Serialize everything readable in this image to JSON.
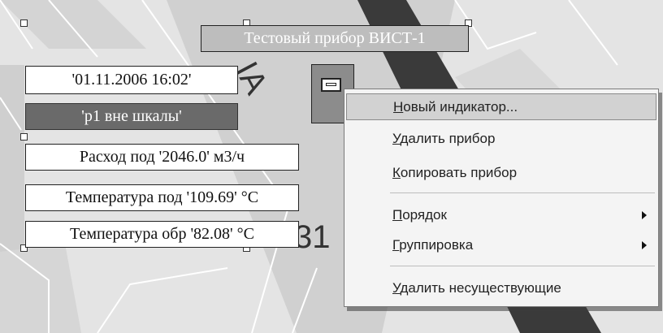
{
  "map": {
    "street_labels": [
      "ІА",
      "31"
    ]
  },
  "device": {
    "title": "Тестовый прибор ВИСТ-1",
    "timestamp": "'01.11.2006  16:02'",
    "out_of_scale": "'p1 вне шкалы'",
    "flow_reading": "Расход под '2046.0' м3/ч",
    "temp_supply": "Температура под '109.69' °С",
    "temp_return": "Температура обр '82.08' °С",
    "icon": "meter-device-icon"
  },
  "context_menu": {
    "items": [
      {
        "accel": "Н",
        "rest": "овый индикатор...",
        "submenu": false,
        "highlighted": true
      },
      {
        "accel": "У",
        "rest": "далить прибор",
        "submenu": false,
        "highlighted": false
      },
      {
        "accel": "К",
        "rest": "опировать прибор",
        "submenu": false,
        "highlighted": false
      },
      {
        "accel": "П",
        "rest": "орядок",
        "submenu": true,
        "highlighted": false
      },
      {
        "accel": "Г",
        "rest": "руппировка",
        "submenu": true,
        "highlighted": false
      },
      {
        "accel": "У",
        "rest": "далить несуществующие",
        "submenu": false,
        "highlighted": false
      }
    ]
  },
  "colors": {
    "road_dark": "#3a3a3a",
    "road_light": "#d0d0d0",
    "out_of_scale_bg": "#6a6a6a",
    "title_bg": "#bdbdbd",
    "menu_highlight": "#d2d2d2"
  }
}
